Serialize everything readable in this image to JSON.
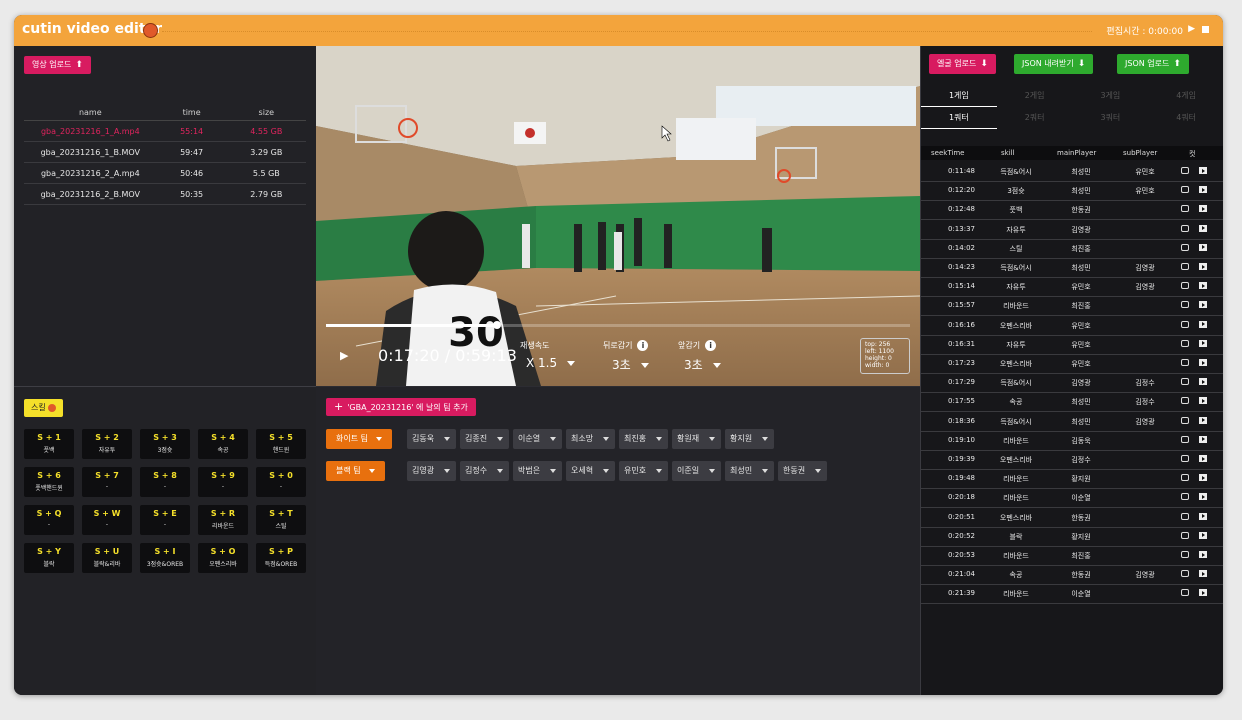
{
  "app": {
    "title": "cutin video editor",
    "recording_time": "편집시간 : 0:00:00"
  },
  "upload": {
    "video_upload_label": "영상 업로드",
    "event_upload_label": "엘굴 업로드",
    "json_export_label": "JSON 내려받기",
    "json_upload_label": "JSON 업로드"
  },
  "files": {
    "columns": [
      "name",
      "time",
      "size"
    ],
    "rows": [
      {
        "name": "gba_20231216_1_A.mp4",
        "time": "55:14",
        "size": "4.55 GB",
        "active": true
      },
      {
        "name": "gba_20231216_1_B.MOV",
        "time": "59:47",
        "size": "3.29 GB",
        "active": false
      },
      {
        "name": "gba_20231216_2_A.mp4",
        "time": "50:46",
        "size": "5.5 GB",
        "active": false
      },
      {
        "name": "gba_20231216_2_B.MOV",
        "time": "50:35",
        "size": "2.79 GB",
        "active": false
      }
    ]
  },
  "skills": {
    "button_label": "스킬",
    "hotkeys": [
      {
        "key": "S + 1",
        "name": "풋백"
      },
      {
        "key": "S + 2",
        "name": "자유투"
      },
      {
        "key": "S + 3",
        "name": "3점슛"
      },
      {
        "key": "S + 4",
        "name": "속공"
      },
      {
        "key": "S + 5",
        "name": "핸드윈"
      },
      {
        "key": "S + 6",
        "name": "풋백핸드윈"
      },
      {
        "key": "S + 7",
        "name": "-"
      },
      {
        "key": "S + 8",
        "name": "-"
      },
      {
        "key": "S + 9",
        "name": "-"
      },
      {
        "key": "S + 0",
        "name": "-"
      },
      {
        "key": "S + Q",
        "name": "-"
      },
      {
        "key": "S + W",
        "name": "-"
      },
      {
        "key": "S + E",
        "name": "-"
      },
      {
        "key": "S + R",
        "name": "리바운드"
      },
      {
        "key": "S + T",
        "name": "스틸"
      },
      {
        "key": "S + Y",
        "name": "블락"
      },
      {
        "key": "S + U",
        "name": "블락&리바"
      },
      {
        "key": "S + I",
        "name": "3점슛&OREB"
      },
      {
        "key": "S + O",
        "name": "오펜스리바"
      },
      {
        "key": "S + P",
        "name": "득점&OREB"
      }
    ]
  },
  "player": {
    "current_time": "0:17:20",
    "duration": "0:59:13",
    "time_display": "0:17:20 / 0:59:13",
    "progress": 0.293,
    "speed_label": "재생속도",
    "speed_value": "X 1.5",
    "rewind_label": "뒤로감기",
    "rewind_value": "3초",
    "forward_label": "앞감기",
    "forward_value": "3초",
    "meta_lines": [
      "top: 256",
      "left: 1100",
      "height: 0",
      "width: 0"
    ],
    "jersey_number": "30"
  },
  "teams": {
    "add_button_label": "'GBA_20231216' 에 날의 팀 추가",
    "white": {
      "label": "화이트 팀",
      "players": [
        "김동욱",
        "김종진",
        "이순열",
        "최소망",
        "최진홍",
        "황원재",
        "황지원"
      ]
    },
    "black": {
      "label": "블랙 팀",
      "players": [
        "김영광",
        "김정수",
        "박범은",
        "오세혁",
        "유민호",
        "이준일",
        "최성민",
        "한동권"
      ]
    }
  },
  "events": {
    "game_tabs": [
      "1게임",
      "2게임",
      "3게임",
      "4게임"
    ],
    "quarter_tabs": [
      "1쿼터",
      "2쿼터",
      "3쿼터",
      "4쿼터"
    ],
    "active_game": 0,
    "active_quarter": 0,
    "columns": [
      "seekTime",
      "skill",
      "mainPlayer",
      "subPlayer",
      "컷"
    ],
    "rows": [
      {
        "time": "0:11:48",
        "skill": "득점&어시",
        "main": "최성민",
        "sub": "유민호"
      },
      {
        "time": "0:12:20",
        "skill": "3점슛",
        "main": "최성민",
        "sub": "유민호"
      },
      {
        "time": "0:12:48",
        "skill": "풋백",
        "main": "한동권",
        "sub": ""
      },
      {
        "time": "0:13:37",
        "skill": "자유투",
        "main": "김영광",
        "sub": ""
      },
      {
        "time": "0:14:02",
        "skill": "스틸",
        "main": "최진홍",
        "sub": ""
      },
      {
        "time": "0:14:23",
        "skill": "득점&어시",
        "main": "최성민",
        "sub": "김영광"
      },
      {
        "time": "0:15:14",
        "skill": "자유투",
        "main": "유민호",
        "sub": "김영광"
      },
      {
        "time": "0:15:57",
        "skill": "리바운드",
        "main": "최진홍",
        "sub": ""
      },
      {
        "time": "0:16:16",
        "skill": "오펜스리바",
        "main": "유민호",
        "sub": ""
      },
      {
        "time": "0:16:31",
        "skill": "자유투",
        "main": "유민호",
        "sub": ""
      },
      {
        "time": "0:17:23",
        "skill": "오펜스리바",
        "main": "유민호",
        "sub": ""
      },
      {
        "time": "0:17:29",
        "skill": "득점&어시",
        "main": "김영광",
        "sub": "김정수"
      },
      {
        "time": "0:17:55",
        "skill": "속공",
        "main": "최성민",
        "sub": "김정수"
      },
      {
        "time": "0:18:36",
        "skill": "득점&어시",
        "main": "최성민",
        "sub": "김영광"
      },
      {
        "time": "0:19:10",
        "skill": "리바운드",
        "main": "김동욱",
        "sub": ""
      },
      {
        "time": "0:19:39",
        "skill": "오펜스리바",
        "main": "김정수",
        "sub": ""
      },
      {
        "time": "0:19:48",
        "skill": "리바운드",
        "main": "황지원",
        "sub": ""
      },
      {
        "time": "0:20:18",
        "skill": "리바운드",
        "main": "이순열",
        "sub": ""
      },
      {
        "time": "0:20:51",
        "skill": "오펜스리바",
        "main": "한동권",
        "sub": ""
      },
      {
        "time": "0:20:52",
        "skill": "블락",
        "main": "황지원",
        "sub": ""
      },
      {
        "time": "0:20:53",
        "skill": "리바운드",
        "main": "최진홍",
        "sub": ""
      },
      {
        "time": "0:21:04",
        "skill": "속공",
        "main": "한동권",
        "sub": "김영광"
      },
      {
        "time": "0:21:39",
        "skill": "리바운드",
        "main": "이순열",
        "sub": ""
      }
    ]
  },
  "colors": {
    "titlebar": "#f3a43c",
    "accent_pink": "#d81b60",
    "accent_green": "#2eaa2e",
    "team_orange": "#e8700e",
    "hotkey_yellow": "#f5e02a"
  }
}
